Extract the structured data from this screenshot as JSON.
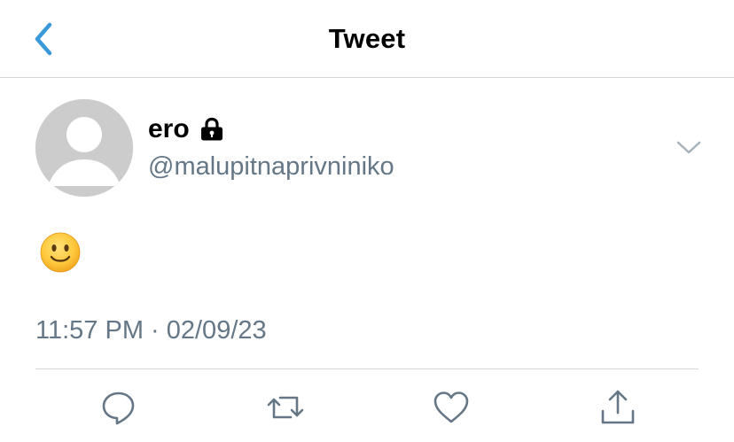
{
  "nav": {
    "title": "Tweet",
    "back_icon": "chevron-left-icon"
  },
  "tweet": {
    "display_name": "ero",
    "protected_icon": "lock-icon",
    "handle": "@malupitnaprivniniko",
    "text": "🙂",
    "timestamp": "11:57 PM · 02/09/23"
  },
  "actions": [
    {
      "name": "reply",
      "icon": "reply-icon"
    },
    {
      "name": "retweet",
      "icon": "retweet-icon"
    },
    {
      "name": "like",
      "icon": "heart-icon"
    },
    {
      "name": "share",
      "icon": "share-icon"
    }
  ],
  "colors": {
    "accent": "#1d9bf0",
    "secondary_text": "#657786",
    "icon_gray": "#657786",
    "divider": "#d4d6d9",
    "avatar_bg": "#cccccc"
  }
}
